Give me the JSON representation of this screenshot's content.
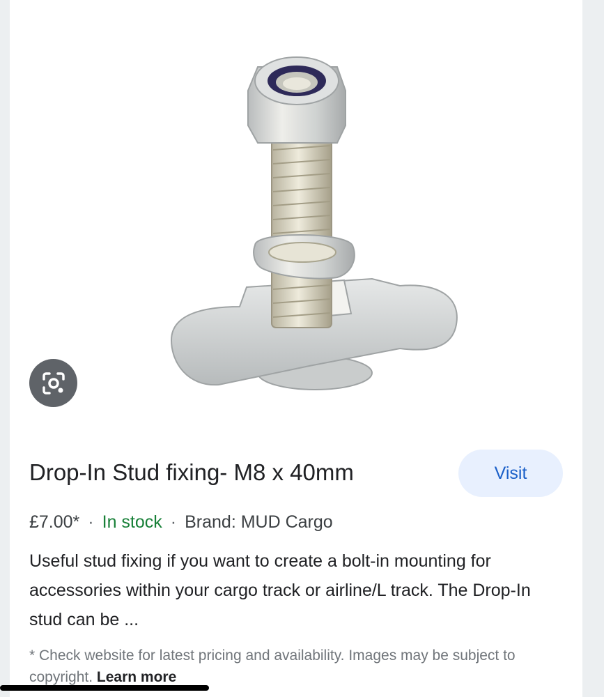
{
  "image": {
    "icon": "lens-icon"
  },
  "product": {
    "title": "Drop-In Stud fixing- M8 x 40mm",
    "visit_label": "Visit",
    "price": "£7.00*",
    "separator": "·",
    "stock": "In stock",
    "brand": "Brand: MUD Cargo",
    "description": "Useful stud fixing if you want to create a bolt-in mounting for accessories within your cargo track or airline/L track. The Drop-In stud can be ...",
    "disclaimer": "* Check website for latest pricing and availability. Images may be subject to copyright.",
    "learn_more": "Learn more"
  },
  "colors": {
    "title": "#202124",
    "stock": "#188038",
    "visit_bg": "#e8f0fe",
    "visit_text": "#1a5fc8",
    "lens_bg": "#5f6368"
  }
}
